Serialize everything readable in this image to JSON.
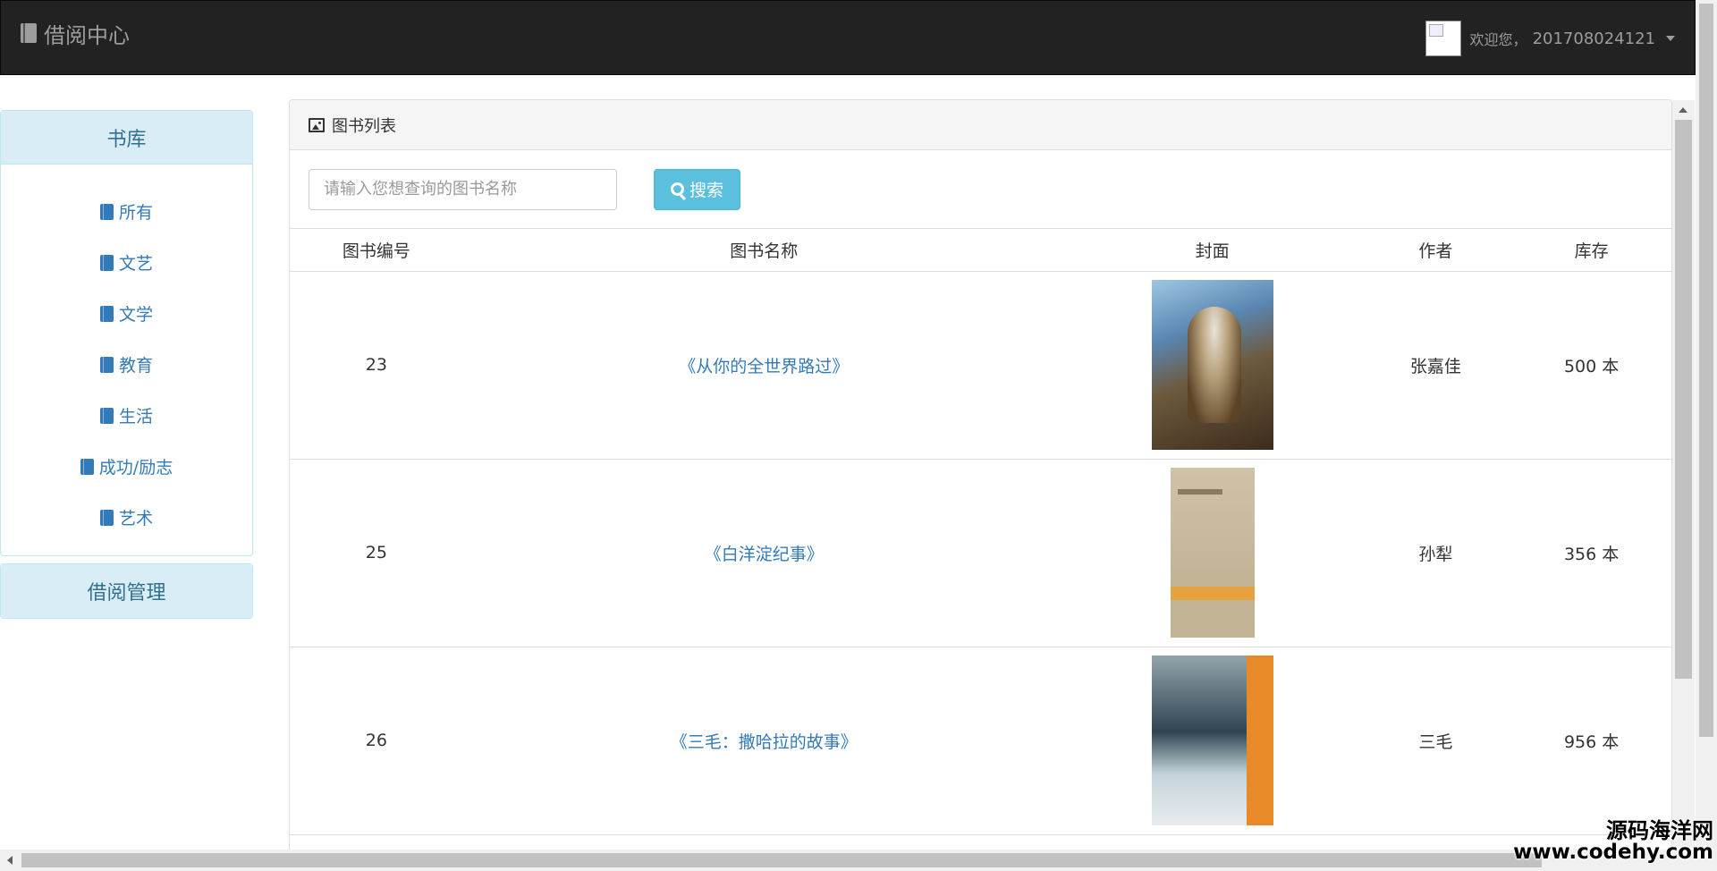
{
  "navbar": {
    "brand": "借阅中心",
    "welcome": "欢迎您，",
    "user_id": "201708024121"
  },
  "sidebar": {
    "library_title": "书库",
    "categories": [
      {
        "label": "所有"
      },
      {
        "label": "文艺"
      },
      {
        "label": "文学"
      },
      {
        "label": "教育"
      },
      {
        "label": "生活"
      },
      {
        "label": "成功/励志"
      },
      {
        "label": "艺术"
      }
    ],
    "borrow_title": "借阅管理"
  },
  "main": {
    "title": "图书列表",
    "search": {
      "placeholder": "请输入您想查询的图书名称",
      "value": "",
      "button_label": "搜索"
    },
    "table": {
      "columns": [
        "图书编号",
        "图书名称",
        "封面",
        "作者",
        "库存"
      ],
      "rows": [
        {
          "id": "23",
          "name": "《从你的全世界路过》",
          "cover": "cover-image",
          "author": "张嘉佳",
          "stock": "500 本"
        },
        {
          "id": "25",
          "name": "《白洋淀纪事》",
          "cover": "cover-image",
          "author": "孙犁",
          "stock": "356 本"
        },
        {
          "id": "26",
          "name": "《三毛：撒哈拉的故事》",
          "cover": "cover-image",
          "author": "三毛",
          "stock": "956 本"
        }
      ]
    }
  },
  "watermark": {
    "line1": "源码海洋网",
    "line2": "www.codehy.com"
  },
  "colors": {
    "navbar_bg": "#222222",
    "link": "#337ab7",
    "info_bg": "#d9edf7",
    "info_text": "#31708f",
    "search_btn": "#5bc0de"
  }
}
